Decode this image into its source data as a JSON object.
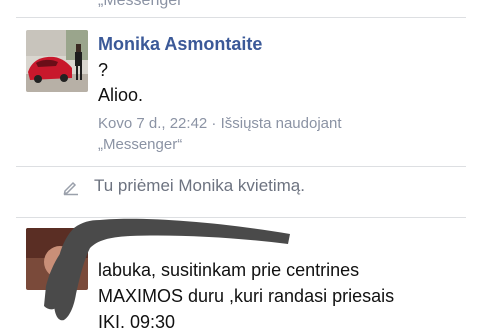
{
  "previous_message": {
    "fragment": "„Messenger“"
  },
  "message_1": {
    "sender": "Monika Asmontaite",
    "lines": [
      "?",
      "Alioo."
    ],
    "timestamp": "Kovo 7 d., 22:42",
    "separator": "·",
    "sent_via": "Išsiųsta naudojant",
    "app": "„Messenger“"
  },
  "system_notice": {
    "text": "Tu priėmei Monika kvietimą."
  },
  "message_2": {
    "lines": [
      "labuka, susitinkam prie centrines",
      "MAXIMOS duru ,kuri randasi priesais",
      "IKI. 09:30"
    ]
  },
  "colors": {
    "name": "#3b5998",
    "meta": "#8b93a4",
    "divider": "#dddfe2",
    "redaction": "#4a4a4a"
  }
}
